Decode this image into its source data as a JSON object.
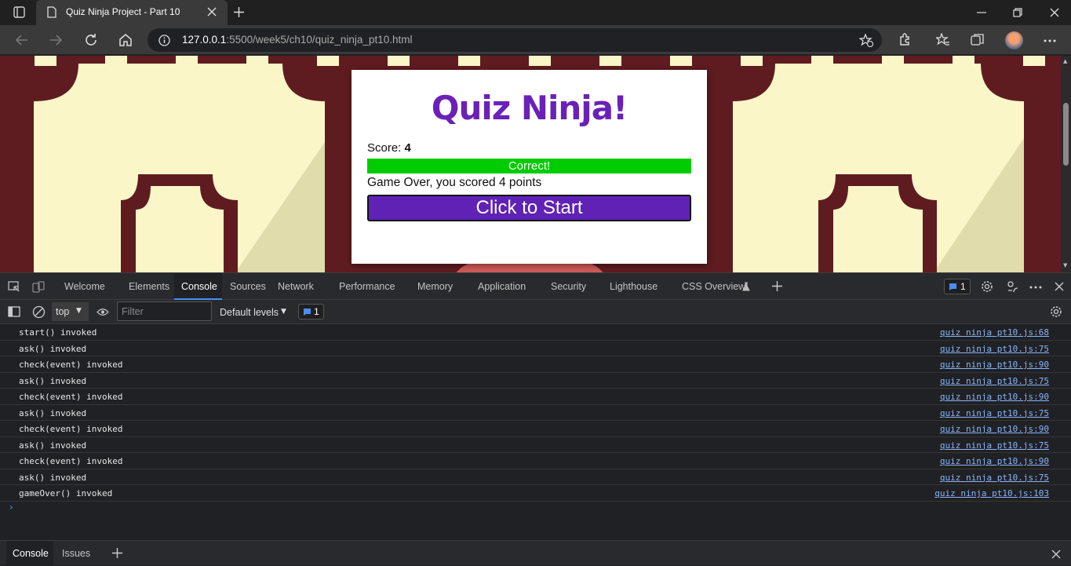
{
  "browser": {
    "tab_title": "Quiz Ninja Project - Part 10",
    "url_host": "127.0.0.1",
    "url_rest": ":5500/week5/ch10/quiz_ninja_pt10.html"
  },
  "quiz": {
    "title": "Quiz Ninja!",
    "score_label": "Score:",
    "score_value": "4",
    "feedback": "Correct!",
    "info": "Game Over, you scored 4 points",
    "start_button": "Click to Start"
  },
  "devtools": {
    "tabs": [
      "Welcome",
      "Elements",
      "Console",
      "Sources",
      "Network",
      "Performance",
      "Memory",
      "Application",
      "Security",
      "Lighthouse",
      "CSS Overview"
    ],
    "active_tab": "Console",
    "issues_count": "1",
    "context": "top",
    "filter_placeholder": "Filter",
    "levels": "Default levels",
    "message_count": "1",
    "logs": [
      {
        "msg": "start() invoked",
        "src": "quiz ninja pt10.js:68"
      },
      {
        "msg": "ask() invoked",
        "src": "quiz ninja pt10.js:75"
      },
      {
        "msg": "check(event) invoked",
        "src": "quiz ninja pt10.js:90"
      },
      {
        "msg": "ask() invoked",
        "src": "quiz ninja pt10.js:75"
      },
      {
        "msg": "check(event) invoked",
        "src": "quiz ninja pt10.js:90"
      },
      {
        "msg": "ask() invoked",
        "src": "quiz ninja pt10.js:75"
      },
      {
        "msg": "check(event) invoked",
        "src": "quiz ninja pt10.js:90"
      },
      {
        "msg": "ask() invoked",
        "src": "quiz ninja pt10.js:75"
      },
      {
        "msg": "check(event) invoked",
        "src": "quiz ninja pt10.js:90"
      },
      {
        "msg": "ask() invoked",
        "src": "quiz ninja pt10.js:75"
      },
      {
        "msg": "gameOver() invoked",
        "src": "quiz ninja pt10.js:103"
      }
    ],
    "drawer_tabs": [
      "Console",
      "Issues"
    ]
  }
}
